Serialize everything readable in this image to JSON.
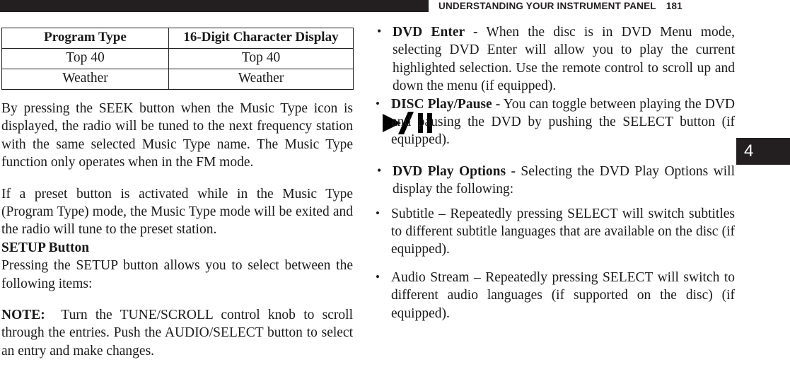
{
  "header": {
    "title": "UNDERSTANDING YOUR INSTRUMENT PANEL",
    "page_number": "181",
    "bar_color": "#231f20"
  },
  "chapter_tab": {
    "number": "4",
    "background": "#231f20",
    "text_color": "#ffffff"
  },
  "left_column": {
    "table": {
      "headers": [
        "Program Type",
        "16-Digit Character Display"
      ],
      "rows": [
        [
          "Top 40",
          "Top 40"
        ],
        [
          "Weather",
          "Weather"
        ]
      ]
    },
    "paragraph_seek": "By pressing the SEEK button when the Music Type icon is displayed, the radio will be tuned to the next frequency station with the same selected Music Type name. The Music Type function only operates when in the FM mode.",
    "paragraph_preset": "If a preset button is activated while in the Music Type (Program Type) mode, the Music Type mode will be exited and the radio will tune to the preset station.",
    "setup_heading": "SETUP Button",
    "paragraph_setup": "Pressing the SETUP button allows you to select between the following items:",
    "note_label": "NOTE:",
    "note_text": "Turn the TUNE/SCROLL control knob to scroll through the entries. Push the AUDIO/SELECT button to select an entry and make changes."
  },
  "right_column": {
    "bullets": [
      {
        "lead_in": "DVD Enter -",
        "text": " When the disc is in DVD Menu mode, selecting DVD Enter will allow you to play the current highlighted selection. Use the remote control to scroll up and down the menu (if equipped)."
      },
      {
        "lead_in": "DVD Play Options -",
        "text": " Selecting the DVD Play Options will display the following:"
      }
    ],
    "sub_bullets_disc": [
      {
        "lead_in": "DISC Play/Pause -",
        "text": " You can toggle between playing the DVD and pausing the DVD by pushing the SELECT button (if equipped)."
      }
    ],
    "sub_bullets_options": [
      {
        "lead_in": "",
        "text": "Subtitle – Repeatedly pressing SELECT will switch subtitles to different subtitle languages that are available on the disc (if equipped)."
      },
      {
        "lead_in": "",
        "text": "Audio Stream – Repeatedly pressing SELECT will switch to different audio languages (if supported on the disc) (if equipped)."
      }
    ],
    "icon_name": "play-pause-icon"
  }
}
